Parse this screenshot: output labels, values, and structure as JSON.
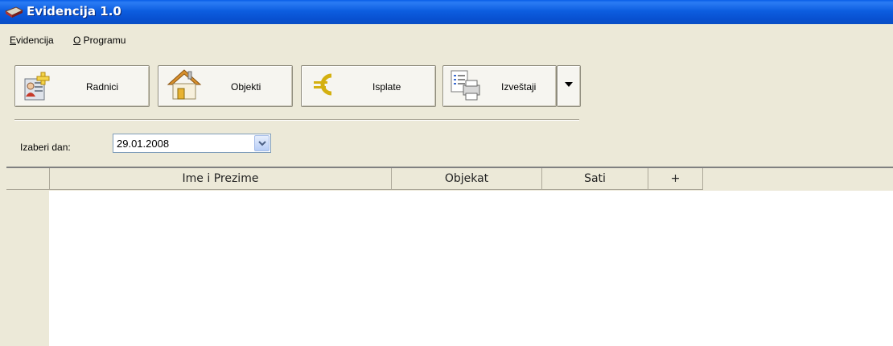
{
  "window": {
    "title": "Evidencija 1.0"
  },
  "menu": {
    "items": [
      {
        "mnemonic": "E",
        "rest": "videncija"
      },
      {
        "mnemonic": "O",
        "rest": " Programu"
      }
    ]
  },
  "toolbar": {
    "radnici_label": "Radnici",
    "objekti_label": "Objekti",
    "isplate_label": "Isplate",
    "izvestaji_label": "Izveštaji"
  },
  "date_picker": {
    "label": "Izaberi dan:",
    "value": "29.01.2008"
  },
  "table": {
    "columns": [
      "Ime i Prezime",
      "Objekat",
      "Sati",
      "+"
    ],
    "rows": []
  },
  "colors": {
    "titlebar": "#0a5ee8",
    "window_bg": "#ece9d8",
    "grid_bg": "#ffffff"
  }
}
